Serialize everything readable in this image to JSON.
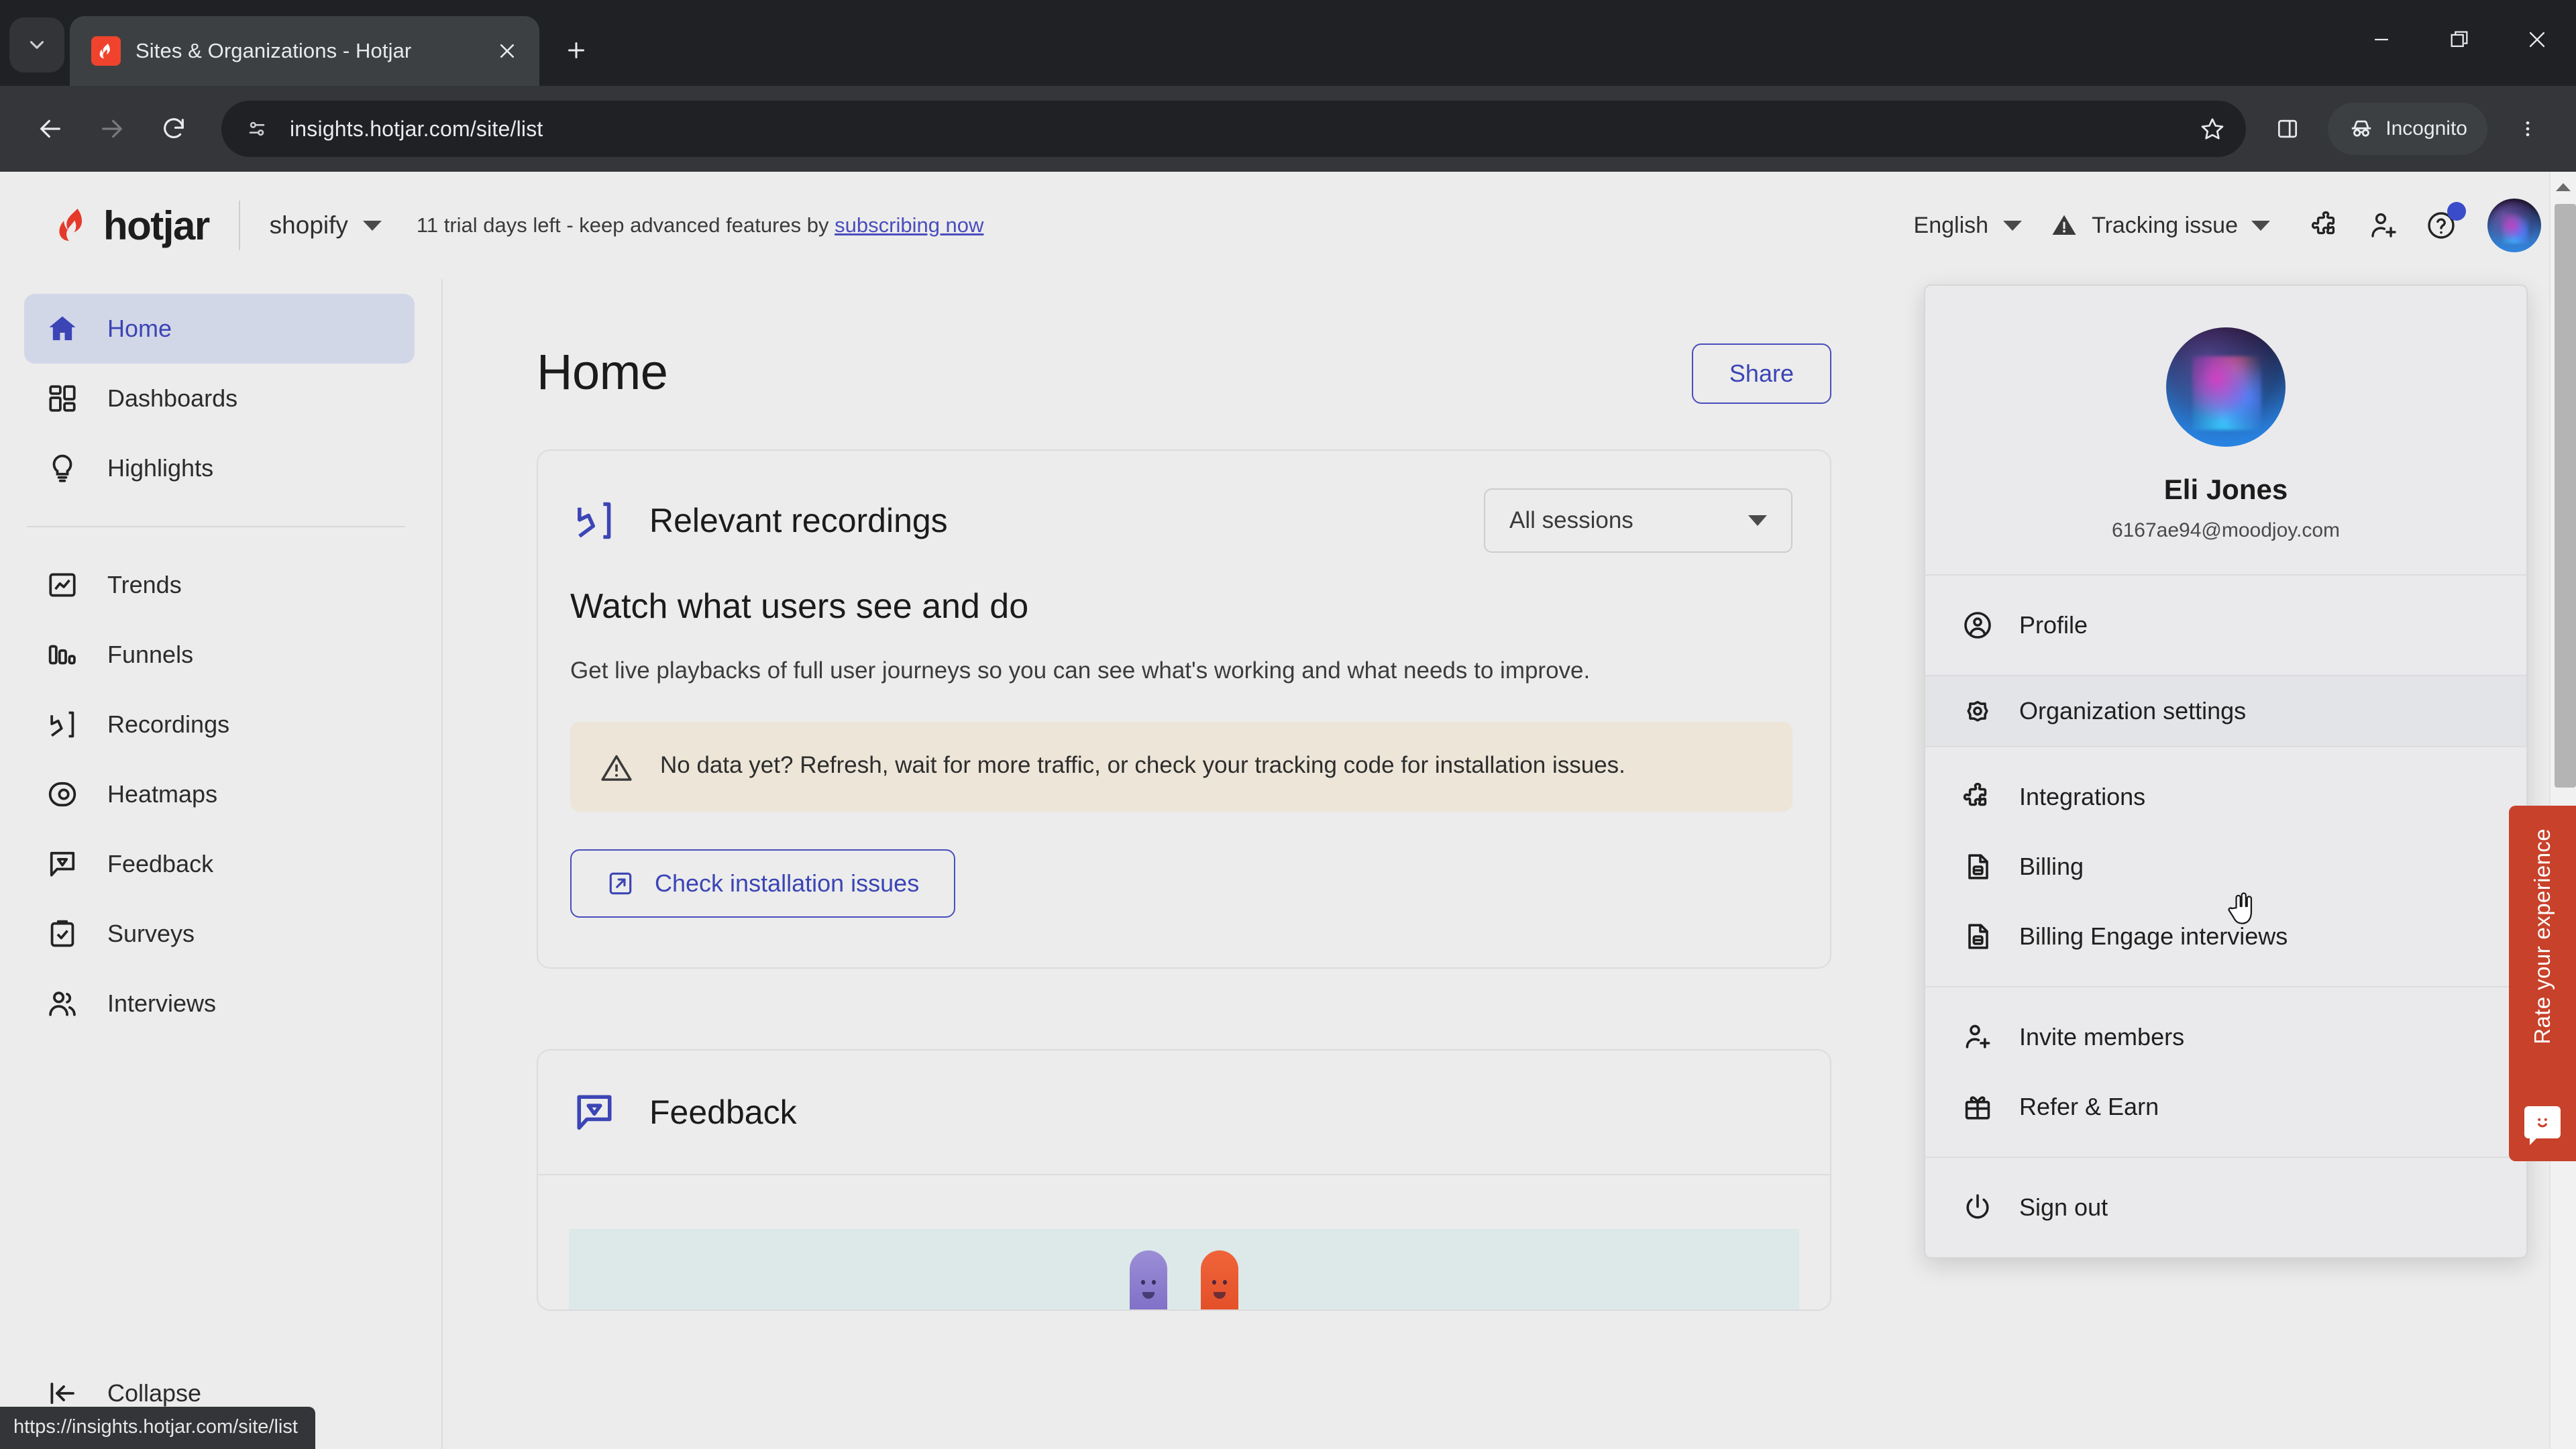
{
  "browser": {
    "tab": {
      "title": "Sites & Organizations - Hotjar",
      "favicon": "hotjar-favicon"
    },
    "new_tab_label": "+",
    "omnibox": {
      "url": "insights.hotjar.com/site/list"
    },
    "incognito_label": "Incognito",
    "window_controls": {
      "minimize": "minimize-icon",
      "maximize": "restore-icon",
      "close": "close-icon"
    },
    "status_link": "https://insights.hotjar.com/site/list"
  },
  "header": {
    "brand": "hotjar",
    "site": "shopify",
    "trial_text": "11 trial days left - keep advanced features by ",
    "trial_link": "subscribing now",
    "language": "English",
    "tracking_status": "Tracking issue"
  },
  "sidebar": {
    "items_top": [
      {
        "label": "Home",
        "icon": "home-icon",
        "active": true
      },
      {
        "label": "Dashboards",
        "icon": "dashboards-icon",
        "active": false
      },
      {
        "label": "Highlights",
        "icon": "highlights-icon",
        "active": false
      }
    ],
    "items_bottom": [
      {
        "label": "Trends",
        "icon": "trends-icon"
      },
      {
        "label": "Funnels",
        "icon": "funnels-icon"
      },
      {
        "label": "Recordings",
        "icon": "recordings-icon"
      },
      {
        "label": "Heatmaps",
        "icon": "heatmaps-icon"
      },
      {
        "label": "Feedback",
        "icon": "feedback-icon"
      },
      {
        "label": "Surveys",
        "icon": "surveys-icon"
      },
      {
        "label": "Interviews",
        "icon": "interviews-icon"
      }
    ],
    "collapse_label": "Collapse"
  },
  "main": {
    "page_title": "Home",
    "share_label": "Share",
    "recordings_card": {
      "title": "Relevant recordings",
      "sessions_filter": "All sessions",
      "heading": "Watch what users see and do",
      "subtext": "Get live playbacks of full user journeys so you can see what's working and what needs to improve.",
      "notice": "No data yet? Refresh, wait for more traffic, or check your tracking code for installation issues.",
      "cta_label": "Check installation issues"
    },
    "feedback_card": {
      "title": "Feedback"
    }
  },
  "profile_menu": {
    "name": "Eli Jones",
    "email": "6167ae94@moodjoy.com",
    "group1": [
      {
        "label": "Profile",
        "icon": "profile-icon",
        "hovered": false
      }
    ],
    "group2": [
      {
        "label": "Organization settings",
        "icon": "gear-icon",
        "hovered": true
      }
    ],
    "group3": [
      {
        "label": "Integrations",
        "icon": "puzzle-icon",
        "hovered": false
      },
      {
        "label": "Billing",
        "icon": "billing-icon",
        "hovered": false
      },
      {
        "label": "Billing Engage interviews",
        "icon": "billing-icon",
        "hovered": false
      }
    ],
    "group4": [
      {
        "label": "Invite members",
        "icon": "invite-member-icon",
        "hovered": false
      },
      {
        "label": "Refer & Earn",
        "icon": "gift-icon",
        "hovered": false
      }
    ],
    "group5": [
      {
        "label": "Sign out",
        "icon": "power-icon",
        "hovered": false
      }
    ]
  },
  "rate_widget": {
    "label": "Rate your experience",
    "color": "#c8412a"
  },
  "colors": {
    "accent": "#3b45b5",
    "brand_red": "#f0432d",
    "notice_bg": "#ece5d8",
    "page_bg": "#ececec",
    "chrome_bg": "#202124"
  }
}
